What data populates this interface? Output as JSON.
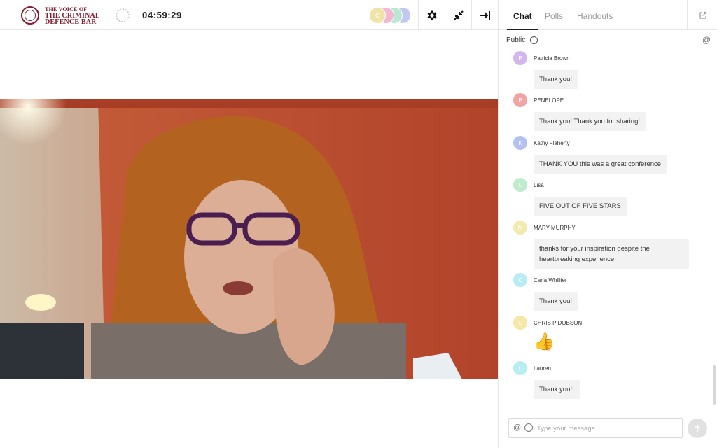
{
  "header": {
    "logo_lines": [
      "THE VOICE OF",
      "THE CRIMINAL",
      "DEFENCE BAR"
    ],
    "timer": "04:59:29",
    "participant_avatars": [
      {
        "initial": "C",
        "color": "#eee4a6"
      },
      {
        "initial": "",
        "color": "#f2b8d2"
      },
      {
        "initial": "",
        "color": "#b9e8d0"
      },
      {
        "initial": "",
        "color": "#c3c8f2"
      }
    ],
    "tools": [
      "settings-icon",
      "minimize-icon",
      "collapse-panel-icon"
    ]
  },
  "panel": {
    "tabs": [
      {
        "label": "Chat",
        "active": true
      },
      {
        "label": "Polls",
        "active": false
      },
      {
        "label": "Handouts",
        "active": false
      }
    ],
    "channel": "Public",
    "messages": [
      {
        "initial": "P",
        "name": "Patricia Brown",
        "text": "Thank you!",
        "color": "#d2b7ef"
      },
      {
        "initial": "P",
        "name": "PENELOPE",
        "text": "Thank you! Thank you for sharing!",
        "color": "#f2a4a4"
      },
      {
        "initial": "K",
        "name": "Kathy Flaherty",
        "text": "THANK YOU this was a great conference",
        "color": "#b3c1f2"
      },
      {
        "initial": "L",
        "name": "Lisa",
        "text": "FIVE OUT OF FIVE STARS",
        "color": "#bfeccb"
      },
      {
        "initial": "M",
        "name": "MARY MURPHY",
        "text": "thanks for your inspiration despite the heartbreaking experience",
        "color": "#f3eab0"
      },
      {
        "initial": "C",
        "name": "Carla Whillier",
        "text": "Thank you!",
        "color": "#b8ecf2"
      },
      {
        "initial": "C",
        "name": "CHRIS P DOBSON",
        "text": "👍",
        "color": "#f5e7a4"
      },
      {
        "initial": "L",
        "name": "Lauren",
        "text": "Thank you!!",
        "color": "#b8eef0"
      }
    ],
    "composer": {
      "placeholder": "Type your message..."
    }
  }
}
